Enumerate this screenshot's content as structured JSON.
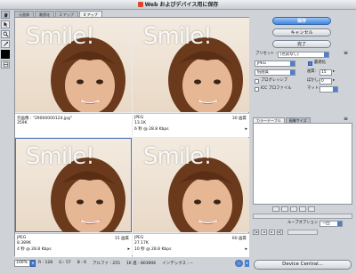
{
  "window": {
    "title": "Web およびデバイス用に保存"
  },
  "toolbox": {
    "tools": [
      "hand-tool-icon",
      "slice-select-icon",
      "zoom-tool-icon",
      "eyedropper-icon"
    ],
    "swatch_color": "#000000"
  },
  "tabs": [
    {
      "label": "元画像"
    },
    {
      "label": "最適化"
    },
    {
      "label": "2 アップ"
    },
    {
      "label": "4 アップ"
    }
  ],
  "panes": [
    {
      "overlay": "Smile!",
      "line1": "元画像 : \"29000000124.jpg\"",
      "line2": "359K",
      "line3": "",
      "right": ""
    },
    {
      "overlay": "Smile!",
      "line1": "JPEG",
      "line2": "13.1K",
      "line3": "6 秒 @ 28.8 Kbps",
      "right": "30 画質"
    },
    {
      "overlay": "Smile!",
      "line1": "JPEG",
      "line2": "8.389K",
      "line3": "4 秒 @ 28.8 Kbps",
      "right": "15 画質"
    },
    {
      "overlay": "Smile!",
      "line1": "JPEG",
      "line2": "27.17K",
      "line3": "10 秒 @ 28.8 Kbps",
      "right": "60 画質"
    }
  ],
  "status": {
    "zoom": "100%",
    "r": "R : 128",
    "g": "G : 57",
    "b": "B : 6",
    "alpha": "アルファ : 255",
    "hex": "16 進 : 803906",
    "index": "インデックス : --"
  },
  "buttons": {
    "save": "保存",
    "cancel": "キャンセル",
    "done": "完了"
  },
  "settings": {
    "preset_label": "プリセット :",
    "preset_value": "[名前なし]",
    "format": "JPEG",
    "quality_mode": "低画質",
    "optimized_label": "最適化",
    "quality_label": "画質:",
    "quality_value": "15",
    "progressive_label": "プログレッシブ",
    "blur_label": "ぼかし:",
    "blur_value": "0",
    "icc_label": "ICC プロファイル",
    "matte_label": "マット:"
  },
  "subtabs": {
    "color_table": "カラーテーブル",
    "image_size": "画像サイズ"
  },
  "animation": {
    "loop_label": "ループオプション :",
    "loop_value": "一回"
  },
  "device_central": "Device Central...",
  "colors": {
    "accent": "#4a7fd1",
    "primary_button": "#3f86e0"
  }
}
